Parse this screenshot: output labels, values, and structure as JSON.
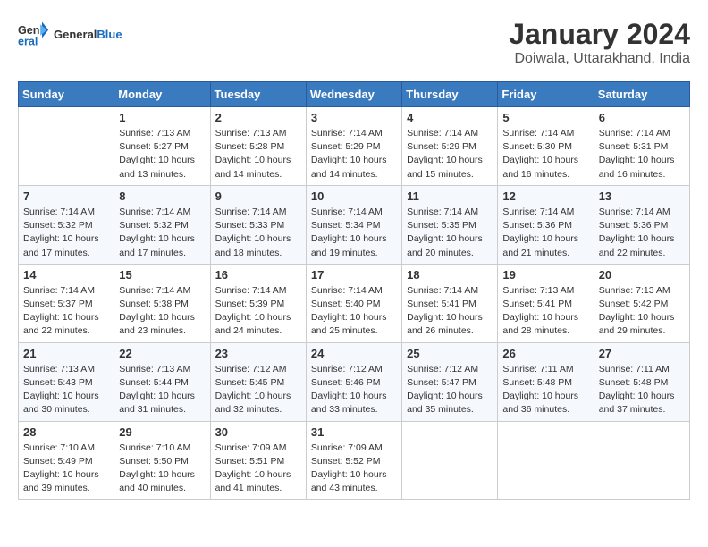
{
  "header": {
    "logo_text_general": "General",
    "logo_text_blue": "Blue",
    "month_year": "January 2024",
    "location": "Doiwala, Uttarakhand, India"
  },
  "calendar": {
    "days_of_week": [
      "Sunday",
      "Monday",
      "Tuesday",
      "Wednesday",
      "Thursday",
      "Friday",
      "Saturday"
    ],
    "weeks": [
      [
        {
          "day": "",
          "sunrise": "",
          "sunset": "",
          "daylight": ""
        },
        {
          "day": "1",
          "sunrise": "Sunrise: 7:13 AM",
          "sunset": "Sunset: 5:27 PM",
          "daylight": "Daylight: 10 hours and 13 minutes."
        },
        {
          "day": "2",
          "sunrise": "Sunrise: 7:13 AM",
          "sunset": "Sunset: 5:28 PM",
          "daylight": "Daylight: 10 hours and 14 minutes."
        },
        {
          "day": "3",
          "sunrise": "Sunrise: 7:14 AM",
          "sunset": "Sunset: 5:29 PM",
          "daylight": "Daylight: 10 hours and 14 minutes."
        },
        {
          "day": "4",
          "sunrise": "Sunrise: 7:14 AM",
          "sunset": "Sunset: 5:29 PM",
          "daylight": "Daylight: 10 hours and 15 minutes."
        },
        {
          "day": "5",
          "sunrise": "Sunrise: 7:14 AM",
          "sunset": "Sunset: 5:30 PM",
          "daylight": "Daylight: 10 hours and 16 minutes."
        },
        {
          "day": "6",
          "sunrise": "Sunrise: 7:14 AM",
          "sunset": "Sunset: 5:31 PM",
          "daylight": "Daylight: 10 hours and 16 minutes."
        }
      ],
      [
        {
          "day": "7",
          "sunrise": "Sunrise: 7:14 AM",
          "sunset": "Sunset: 5:32 PM",
          "daylight": "Daylight: 10 hours and 17 minutes."
        },
        {
          "day": "8",
          "sunrise": "Sunrise: 7:14 AM",
          "sunset": "Sunset: 5:32 PM",
          "daylight": "Daylight: 10 hours and 17 minutes."
        },
        {
          "day": "9",
          "sunrise": "Sunrise: 7:14 AM",
          "sunset": "Sunset: 5:33 PM",
          "daylight": "Daylight: 10 hours and 18 minutes."
        },
        {
          "day": "10",
          "sunrise": "Sunrise: 7:14 AM",
          "sunset": "Sunset: 5:34 PM",
          "daylight": "Daylight: 10 hours and 19 minutes."
        },
        {
          "day": "11",
          "sunrise": "Sunrise: 7:14 AM",
          "sunset": "Sunset: 5:35 PM",
          "daylight": "Daylight: 10 hours and 20 minutes."
        },
        {
          "day": "12",
          "sunrise": "Sunrise: 7:14 AM",
          "sunset": "Sunset: 5:36 PM",
          "daylight": "Daylight: 10 hours and 21 minutes."
        },
        {
          "day": "13",
          "sunrise": "Sunrise: 7:14 AM",
          "sunset": "Sunset: 5:36 PM",
          "daylight": "Daylight: 10 hours and 22 minutes."
        }
      ],
      [
        {
          "day": "14",
          "sunrise": "Sunrise: 7:14 AM",
          "sunset": "Sunset: 5:37 PM",
          "daylight": "Daylight: 10 hours and 22 minutes."
        },
        {
          "day": "15",
          "sunrise": "Sunrise: 7:14 AM",
          "sunset": "Sunset: 5:38 PM",
          "daylight": "Daylight: 10 hours and 23 minutes."
        },
        {
          "day": "16",
          "sunrise": "Sunrise: 7:14 AM",
          "sunset": "Sunset: 5:39 PM",
          "daylight": "Daylight: 10 hours and 24 minutes."
        },
        {
          "day": "17",
          "sunrise": "Sunrise: 7:14 AM",
          "sunset": "Sunset: 5:40 PM",
          "daylight": "Daylight: 10 hours and 25 minutes."
        },
        {
          "day": "18",
          "sunrise": "Sunrise: 7:14 AM",
          "sunset": "Sunset: 5:41 PM",
          "daylight": "Daylight: 10 hours and 26 minutes."
        },
        {
          "day": "19",
          "sunrise": "Sunrise: 7:13 AM",
          "sunset": "Sunset: 5:41 PM",
          "daylight": "Daylight: 10 hours and 28 minutes."
        },
        {
          "day": "20",
          "sunrise": "Sunrise: 7:13 AM",
          "sunset": "Sunset: 5:42 PM",
          "daylight": "Daylight: 10 hours and 29 minutes."
        }
      ],
      [
        {
          "day": "21",
          "sunrise": "Sunrise: 7:13 AM",
          "sunset": "Sunset: 5:43 PM",
          "daylight": "Daylight: 10 hours and 30 minutes."
        },
        {
          "day": "22",
          "sunrise": "Sunrise: 7:13 AM",
          "sunset": "Sunset: 5:44 PM",
          "daylight": "Daylight: 10 hours and 31 minutes."
        },
        {
          "day": "23",
          "sunrise": "Sunrise: 7:12 AM",
          "sunset": "Sunset: 5:45 PM",
          "daylight": "Daylight: 10 hours and 32 minutes."
        },
        {
          "day": "24",
          "sunrise": "Sunrise: 7:12 AM",
          "sunset": "Sunset: 5:46 PM",
          "daylight": "Daylight: 10 hours and 33 minutes."
        },
        {
          "day": "25",
          "sunrise": "Sunrise: 7:12 AM",
          "sunset": "Sunset: 5:47 PM",
          "daylight": "Daylight: 10 hours and 35 minutes."
        },
        {
          "day": "26",
          "sunrise": "Sunrise: 7:11 AM",
          "sunset": "Sunset: 5:48 PM",
          "daylight": "Daylight: 10 hours and 36 minutes."
        },
        {
          "day": "27",
          "sunrise": "Sunrise: 7:11 AM",
          "sunset": "Sunset: 5:48 PM",
          "daylight": "Daylight: 10 hours and 37 minutes."
        }
      ],
      [
        {
          "day": "28",
          "sunrise": "Sunrise: 7:10 AM",
          "sunset": "Sunset: 5:49 PM",
          "daylight": "Daylight: 10 hours and 39 minutes."
        },
        {
          "day": "29",
          "sunrise": "Sunrise: 7:10 AM",
          "sunset": "Sunset: 5:50 PM",
          "daylight": "Daylight: 10 hours and 40 minutes."
        },
        {
          "day": "30",
          "sunrise": "Sunrise: 7:09 AM",
          "sunset": "Sunset: 5:51 PM",
          "daylight": "Daylight: 10 hours and 41 minutes."
        },
        {
          "day": "31",
          "sunrise": "Sunrise: 7:09 AM",
          "sunset": "Sunset: 5:52 PM",
          "daylight": "Daylight: 10 hours and 43 minutes."
        },
        {
          "day": "",
          "sunrise": "",
          "sunset": "",
          "daylight": ""
        },
        {
          "day": "",
          "sunrise": "",
          "sunset": "",
          "daylight": ""
        },
        {
          "day": "",
          "sunrise": "",
          "sunset": "",
          "daylight": ""
        }
      ]
    ]
  }
}
